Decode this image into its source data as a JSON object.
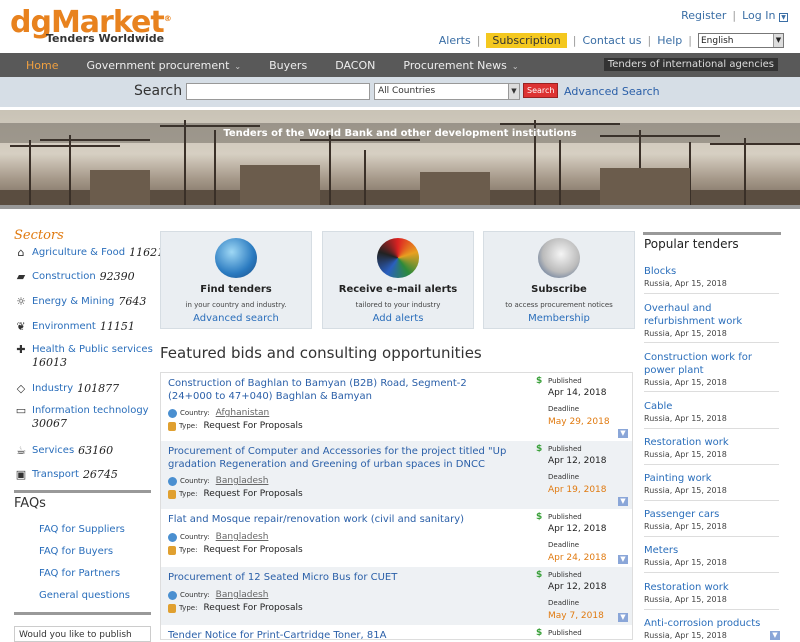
{
  "brand": {
    "name": "dgMarket",
    "tagline": "Tenders Worldwide",
    "mark": "®"
  },
  "header": {
    "register": "Register",
    "login": "Log In",
    "alerts": "Alerts",
    "subscription": "Subscription",
    "contact": "Contact us",
    "help": "Help",
    "language": "English"
  },
  "nav": {
    "items": [
      {
        "label": "Home"
      },
      {
        "label": "Government procurement"
      },
      {
        "label": "Buyers"
      },
      {
        "label": "DACON"
      },
      {
        "label": "Procurement News"
      }
    ],
    "right_label": "Tenders of international agencies"
  },
  "search": {
    "label": "Search",
    "placeholder": "",
    "country": "All Countries",
    "button": "Search",
    "advanced": "Advanced Search"
  },
  "banner": {
    "caption": "Tenders of the World Bank and other development institutions"
  },
  "sectors": {
    "title": "Sectors",
    "items": [
      {
        "name": "Agriculture & Food",
        "count": "11621",
        "icon": "farm-icon"
      },
      {
        "name": "Construction",
        "count": "92390",
        "icon": "construction-truck-icon"
      },
      {
        "name": "Energy & Mining",
        "count": "7643",
        "icon": "sun-icon"
      },
      {
        "name": "Environment",
        "count": "11151",
        "icon": "leaf-icon"
      },
      {
        "name": "Health & Public services",
        "count": "16013",
        "icon": "medical-kit-icon"
      },
      {
        "name": "Industry",
        "count": "101877",
        "icon": "diamond-icon"
      },
      {
        "name": "Information technology",
        "count": "30067",
        "icon": "monitor-icon"
      },
      {
        "name": "Services",
        "count": "63160",
        "icon": "coffee-cup-icon"
      },
      {
        "name": "Transport",
        "count": "26745",
        "icon": "bus-icon"
      }
    ]
  },
  "faqs": {
    "title": "FAQs",
    "items": [
      "FAQ for Suppliers",
      "FAQ for Buyers",
      "FAQ for Partners",
      "General questions"
    ]
  },
  "publish": {
    "text": "Would you like to publish"
  },
  "cards": [
    {
      "title": "Find tenders",
      "sub": "in your country and industry.",
      "link": "Advanced search"
    },
    {
      "title": "Receive e-mail alerts",
      "sub": "tailored to your industry",
      "link": "Add alerts"
    },
    {
      "title": "Subscribe",
      "sub": "to access procurement notices",
      "link": "Membership"
    }
  ],
  "featured": {
    "title": "Featured bids and consulting opportunities",
    "country_label": "Country:",
    "type_label": "Type:",
    "published_label": "Published",
    "deadline_label": "Deadline",
    "bids": [
      {
        "title": "Construction of Baghlan to Bamyan (B2B) Road, Segment-2 (24+000 to 47+040) Baghlan & Bamyan",
        "country": "Afghanistan",
        "type": "Request For Proposals",
        "published": "Apr 14, 2018",
        "deadline": "May 29, 2018"
      },
      {
        "title": "Procurement of Computer and Accessories for the project titled \"Up gradation Regeneration and Greening of urban spaces in DNCC",
        "country": "Bangladesh",
        "type": "Request For Proposals",
        "published": "Apr 12, 2018",
        "deadline": "Apr 19, 2018"
      },
      {
        "title": "Flat and Mosque repair/renovation work (civil and sanitary)",
        "country": "Bangladesh",
        "type": "Request For Proposals",
        "published": "Apr 12, 2018",
        "deadline": "Apr 24, 2018"
      },
      {
        "title": "Procurement of 12 Seated Micro Bus for CUET",
        "country": "Bangladesh",
        "type": "Request For Proposals",
        "published": "Apr 12, 2018",
        "deadline": "May 7, 2018"
      },
      {
        "title": "Tender Notice for Print-Cartridge Toner, 81A",
        "published": "Published"
      }
    ]
  },
  "popular": {
    "title": "Popular tenders",
    "items": [
      {
        "name": "Blocks",
        "loc": "Russia, Apr 15, 2018"
      },
      {
        "name": "Overhaul and refurbishment work",
        "loc": "Russia, Apr 15, 2018"
      },
      {
        "name": "Construction work for power plant",
        "loc": "Russia, Apr 15, 2018"
      },
      {
        "name": "Cable",
        "loc": "Russia, Apr 15, 2018"
      },
      {
        "name": "Restoration work",
        "loc": "Russia, Apr 15, 2018"
      },
      {
        "name": "Painting work",
        "loc": "Russia, Apr 15, 2018"
      },
      {
        "name": "Passenger cars",
        "loc": "Russia, Apr 15, 2018"
      },
      {
        "name": "Meters",
        "loc": "Russia, Apr 15, 2018"
      },
      {
        "name": "Restoration work",
        "loc": "Russia, Apr 15, 2018"
      },
      {
        "name": "Anti-corrosion products",
        "loc": "Russia, Apr 15, 2018"
      }
    ]
  },
  "colors": {
    "brand_orange": "#e8821e",
    "nav": "#595959",
    "link": "#2a6ebb",
    "subscription": "#f4c81f"
  }
}
